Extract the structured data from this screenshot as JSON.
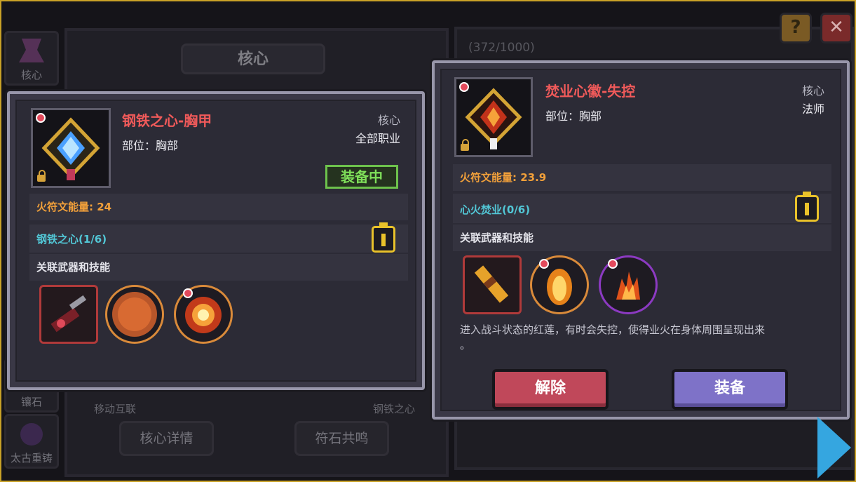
{
  "background": {
    "side_tabs": [
      "核心",
      "镶石",
      "太古重铸"
    ],
    "panel_title": "核心",
    "labels": {
      "left": "移动互联",
      "right": "钢铁之心"
    },
    "buttons": {
      "detail": "核心详情",
      "resonance": "符石共鸣"
    },
    "counter": "(372/1000)"
  },
  "top_buttons": {
    "help": "?",
    "close": "✕"
  },
  "left_card": {
    "name": "钢铁之心-胸甲",
    "slot": "部位：胸部",
    "type": "核心",
    "class": "全部职业",
    "status": "装备中",
    "energy": "火符文能量: 24",
    "set": "钢铁之心(1/6)",
    "related": "关联武器和技能"
  },
  "right_card": {
    "name": "焚业心徽-失控",
    "slot": "部位：胸部",
    "type": "核心",
    "class": "法师",
    "energy": "火符文能量: 23.9",
    "set": "心火焚业(0/6)",
    "related": "关联武器和技能",
    "description_1": "进入战斗状态的红莲，有时会失控，使得业火在身体周围呈现出来",
    "description_2": "。",
    "remove_label": "解除",
    "equip_label": "装备"
  },
  "colors": {
    "item_name": "#f05a5a",
    "energy": "#f2a03a",
    "set": "#52c7d6",
    "equipped": "#7fe05a",
    "remove_button": "#c0485a",
    "equip_button": "#7e72c8",
    "frame": "#c9a227"
  },
  "icons": [
    "gem-icon",
    "lock-icon",
    "set-bonus-icon",
    "weapon-icon",
    "skill-icon",
    "help-icon",
    "close-icon",
    "next-arrow-icon"
  ]
}
